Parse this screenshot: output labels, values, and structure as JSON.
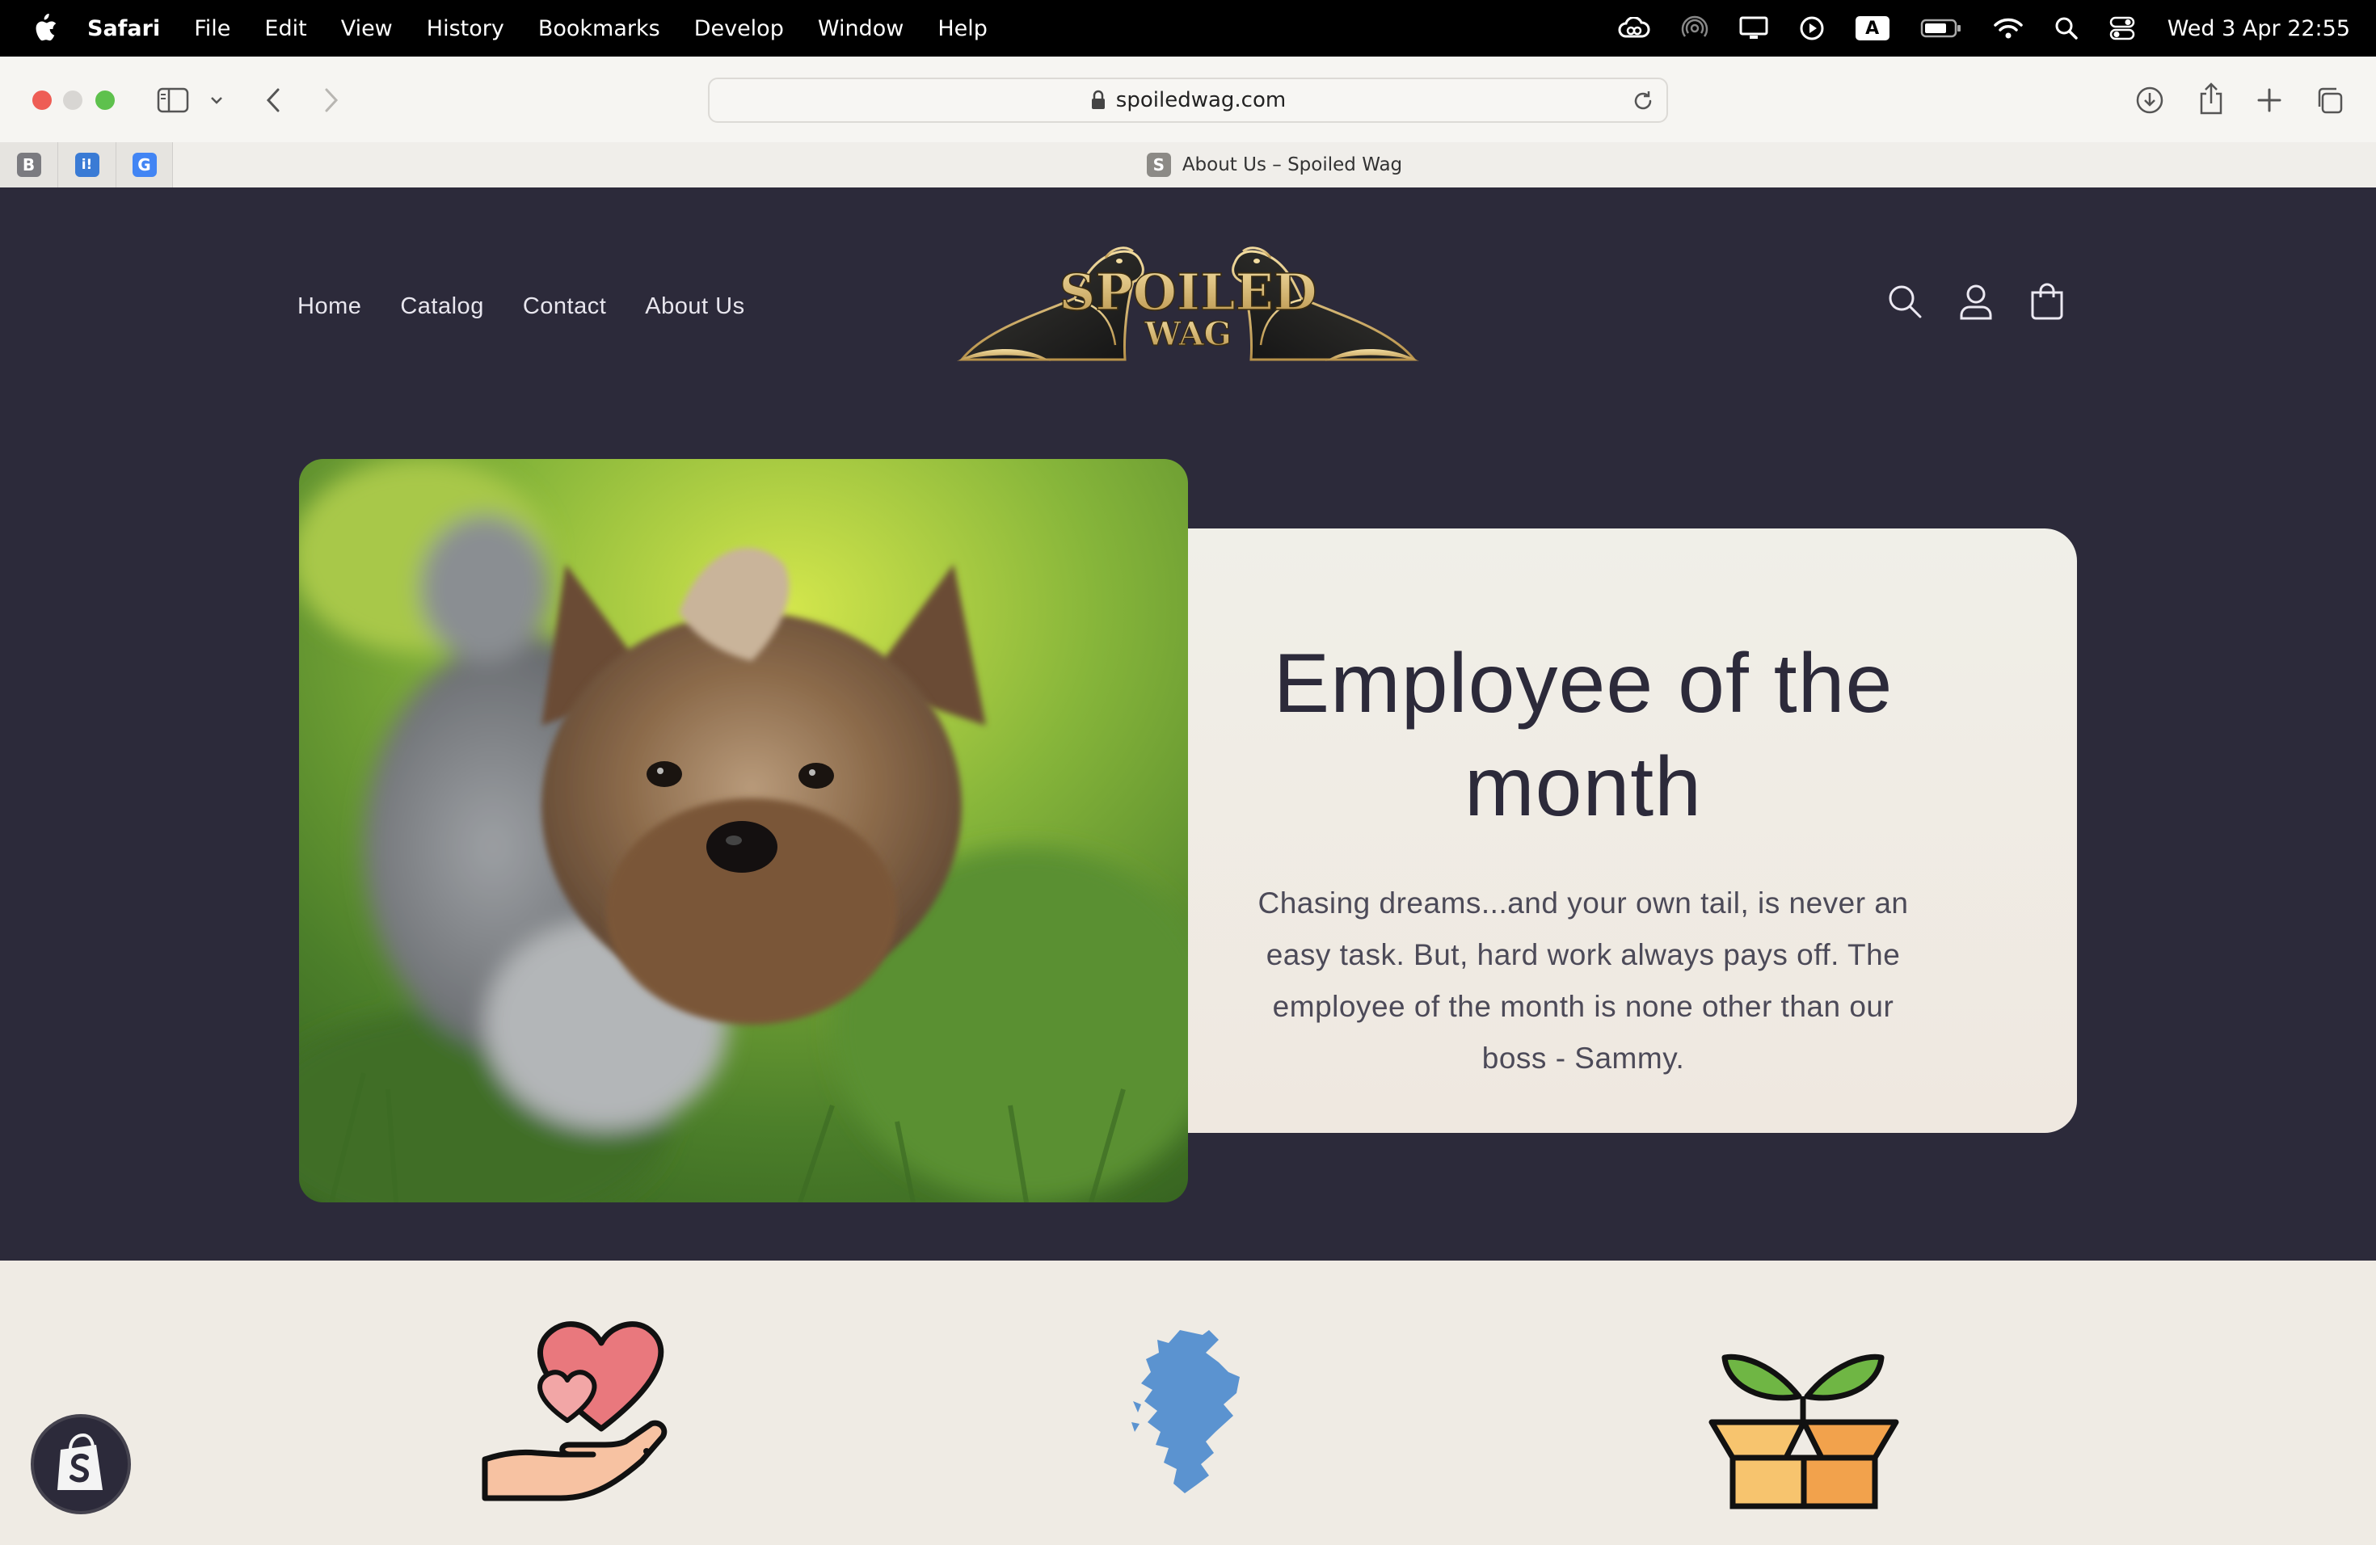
{
  "menubar": {
    "app_name": "Safari",
    "items": [
      "File",
      "Edit",
      "View",
      "History",
      "Bookmarks",
      "Develop",
      "Window",
      "Help"
    ],
    "status_icons": [
      "creative-cloud-icon",
      "airdrop-icon",
      "display-icon",
      "play-icon",
      "input-source-icon",
      "battery-icon",
      "wifi-icon",
      "spotlight-icon",
      "control-center-icon"
    ],
    "input_source": "A",
    "clock": "Wed 3 Apr  22:55"
  },
  "browser": {
    "url": "spoiledwag.com",
    "pinned_tabs": [
      "B",
      "i!",
      "G"
    ],
    "active_tab": {
      "favicon_letter": "S",
      "title": "About Us – Spoiled Wag"
    }
  },
  "site": {
    "nav": [
      "Home",
      "Catalog",
      "Contact",
      "About Us"
    ],
    "logo_text_top": "SPOILED",
    "logo_text_bottom": "WAG",
    "header_icons": [
      "search-icon",
      "account-icon",
      "cart-icon"
    ],
    "hero": {
      "heading": "Employee of the month",
      "body": "Chasing dreams...and your own tail, is never an easy task. But, hard work always pays off. The employee of the month is none other than our boss - Sammy."
    },
    "features": [
      "hand-heart-icon",
      "scotland-map-icon",
      "plant-box-icon"
    ]
  },
  "colors": {
    "page_bg": "#2c2a3a",
    "card_bg": "#efede6",
    "strip_bg": "#efebe4",
    "heading": "#2c2a3a",
    "logo_gold": "#d9bb7a"
  }
}
